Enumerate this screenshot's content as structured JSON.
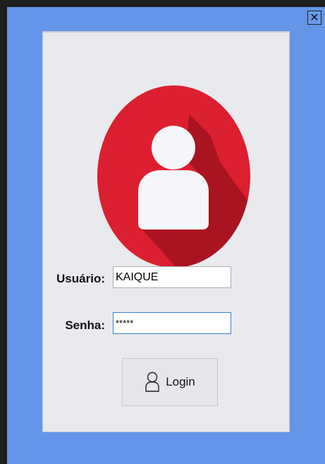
{
  "window": {
    "close_glyph": "✕",
    "background_color": "#6495e9"
  },
  "login_form": {
    "username_label": "Usuário:",
    "username_value": "KAIQUE",
    "password_label": "Senha:",
    "password_value": "*****",
    "login_button_label": "Login",
    "accent_color": "#d8202f"
  },
  "icons": {
    "avatar": "user-avatar-icon",
    "login": "user-outline-icon"
  }
}
